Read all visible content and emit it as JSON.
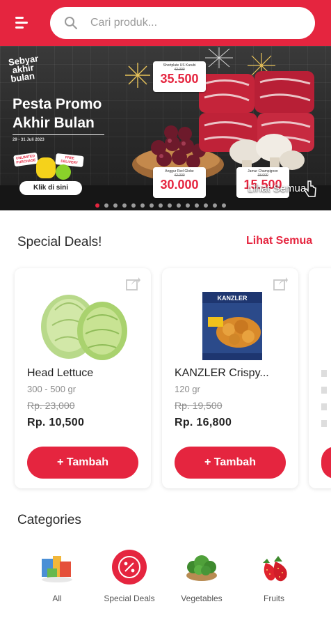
{
  "header": {
    "search": {
      "placeholder": "Cari produk...",
      "value": ""
    },
    "menu_icon": "hamburger-menu-icon",
    "search_icon": "search-icon"
  },
  "banner": {
    "logo_lines": [
      "Sebyar",
      "akhir",
      "bulan"
    ],
    "title_line1": "Pesta Promo",
    "title_line2": "Akhir Bulan",
    "date": "29 - 31 Juli 2023",
    "sticker_left": "UNLIMITED PURCHASE",
    "sticker_right": "FREE DELIVERY",
    "cta": "Klik di sini",
    "see_all": "Lihat Semua",
    "tags": [
      {
        "name": "Shortplate US Karubi",
        "old": "42.000",
        "price": "35.500"
      },
      {
        "name": "Anggur Red Globe",
        "old": "42.000",
        "price": "30.000"
      },
      {
        "name": "Jamur Champignon",
        "old": "18.000",
        "price": "15.500"
      }
    ],
    "slide_count": 15,
    "active_slide": 0
  },
  "special_deals": {
    "title": "Special Deals!",
    "see_all": "Lihat Semua",
    "items": [
      {
        "name": "Head Lettuce",
        "weight": "300 - 500 gr",
        "old_price": "Rp. 23,000",
        "price": "Rp. 10,500",
        "button": "+ Tambah",
        "image_icon": "lettuce-image",
        "share_icon": "share-icon"
      },
      {
        "name": "KANZLER Crispy...",
        "weight": "120 gr",
        "old_price": "Rp. 19,500",
        "price": "Rp. 16,800",
        "button": "+ Tambah",
        "image_icon": "kanzler-package-image",
        "share_icon": "share-icon"
      }
    ]
  },
  "categories": {
    "title": "Categories",
    "items": [
      {
        "label": "All",
        "icon": "all-groceries-icon"
      },
      {
        "label": "Special Deals",
        "icon": "percent-badge-icon"
      },
      {
        "label": "Vegetables",
        "icon": "vegetables-icon"
      },
      {
        "label": "Fruits",
        "icon": "strawberry-icon"
      }
    ]
  },
  "colors": {
    "brand_red": "#e5253f",
    "text_dark": "#222222",
    "text_muted": "#8c8c8c"
  }
}
